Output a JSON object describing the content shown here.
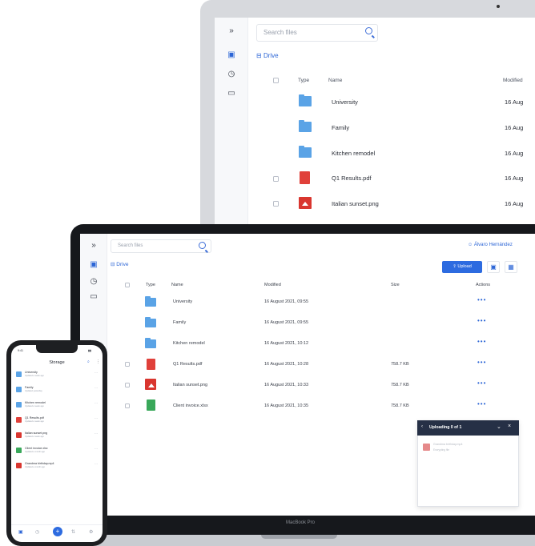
{
  "imac": {
    "search_placeholder": "Search files",
    "breadcrumb": "Drive",
    "columns": [
      "Type",
      "Name",
      "Modified"
    ],
    "rows": [
      {
        "name": "University",
        "modified": "16 Aug",
        "type": "folder"
      },
      {
        "name": "Family",
        "modified": "16 Aug",
        "type": "folder"
      },
      {
        "name": "Kitchen remodel",
        "modified": "16 Aug",
        "type": "folder"
      },
      {
        "name": "Q1 Results.pdf",
        "modified": "16 Aug",
        "type": "pdf"
      },
      {
        "name": "Italian sunset.png",
        "modified": "16 Aug",
        "type": "image"
      }
    ]
  },
  "macbook": {
    "search_placeholder": "Search files",
    "user_name": "Álvaro Hernández",
    "breadcrumb": "Drive",
    "upload_label": "Upload",
    "columns": [
      "Type",
      "Name",
      "Modified",
      "Size",
      "Actions"
    ],
    "rows": [
      {
        "name": "University",
        "modified": "16 August 2021, 09:55",
        "size": "",
        "type": "folder"
      },
      {
        "name": "Family",
        "modified": "16 August 2021, 09:55",
        "size": "",
        "type": "folder"
      },
      {
        "name": "Kitchen remodel",
        "modified": "16 August 2021, 10:12",
        "size": "",
        "type": "folder"
      },
      {
        "name": "Q1 Results.pdf",
        "modified": "16 August 2021, 10:28",
        "size": "758.7 KB",
        "type": "pdf"
      },
      {
        "name": "Italian sunset.png",
        "modified": "16 August 2021, 10:33",
        "size": "758.7 KB",
        "type": "image"
      },
      {
        "name": "Client invoice.xlsx",
        "modified": "16 August 2021, 10:35",
        "size": "758.7 KB",
        "type": "spreadsheet"
      }
    ],
    "actions_glyph": "•••",
    "upload_panel": {
      "title": "Uploading 0 of 1",
      "file_name": "Grandma birthday.mp4",
      "file_status": "Encrypting file"
    },
    "device_label": "MacBook Pro"
  },
  "phone": {
    "time": "9:41",
    "title": "Storage",
    "rows": [
      {
        "name": "University",
        "sub": "Updated a week ago",
        "type": "folder"
      },
      {
        "name": "Family",
        "sub": "Updated yesterday",
        "type": "folder"
      },
      {
        "name": "Kitchen remodel",
        "sub": "Updated a week ago",
        "type": "folder"
      },
      {
        "name": "Q1 Results.pdf",
        "sub": "Updated a week ago",
        "type": "pdf"
      },
      {
        "name": "Italian sunset.png",
        "sub": "Updated a week ago",
        "type": "image"
      },
      {
        "name": "Client invoice.xlsx",
        "sub": "Updated a month ago",
        "type": "spreadsheet"
      },
      {
        "name": "Grandma birthday.mp4",
        "sub": "Updated a month ago",
        "type": "video"
      }
    ]
  },
  "colors": {
    "accent": "#2d6be0",
    "folder": "#5aa3e6",
    "pdf": "#e0403a",
    "image": "#d9362f",
    "spreadsheet": "#39a85a",
    "panel_header": "#263046"
  }
}
